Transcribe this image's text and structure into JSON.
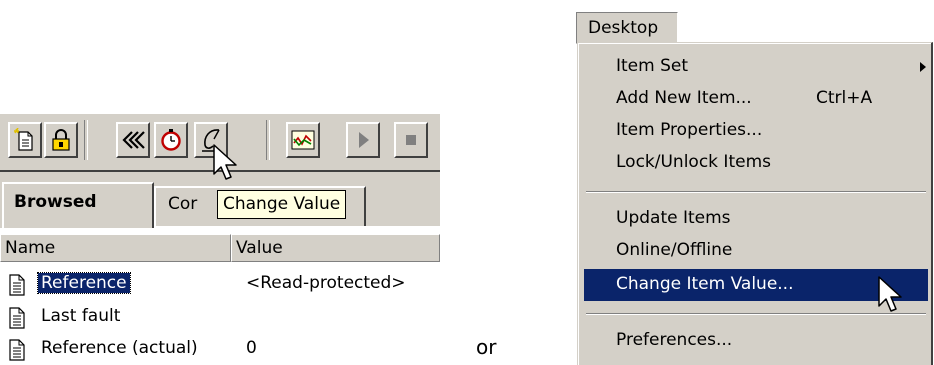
{
  "left_panel": {
    "toolbar": {
      "buttons": [
        {
          "icon": "new-item-icon"
        },
        {
          "icon": "lock-icon"
        },
        {
          "icon": "rewind-icon"
        },
        {
          "icon": "timer-icon"
        },
        {
          "icon": "change-value-pen-icon"
        },
        {
          "icon": "trend-chart-icon"
        },
        {
          "icon": "play-icon"
        },
        {
          "icon": "stop-icon"
        }
      ]
    },
    "tooltip": "Change Value",
    "tabs": [
      {
        "label": "Browsed"
      },
      {
        "label": "Cor"
      }
    ],
    "list": {
      "columns": [
        "Name",
        "Value"
      ],
      "rows": [
        {
          "name": "Reference",
          "value": "<Read-protected>",
          "selected": true
        },
        {
          "name": "Last fault",
          "value": ""
        },
        {
          "name": "Reference (actual)",
          "value": "0"
        }
      ]
    }
  },
  "separator_text": "or",
  "right_panel": {
    "menubar": {
      "label": "Desktop"
    },
    "menu": {
      "items": [
        {
          "label": "Item Set",
          "submenu": true
        },
        {
          "label": "Add New Item...",
          "shortcut": "Ctrl+A"
        },
        {
          "label": "Item Properties..."
        },
        {
          "label": "Lock/Unlock Items"
        },
        {
          "label": "Update Items"
        },
        {
          "label": "Online/Offline"
        },
        {
          "label": "Change Item Value...",
          "highlighted": true
        },
        {
          "label": "Preferences..."
        }
      ]
    }
  },
  "colors": {
    "face": "#d4d0c8",
    "highlight": "#0a246a",
    "tooltip_bg": "#ffffe1"
  }
}
